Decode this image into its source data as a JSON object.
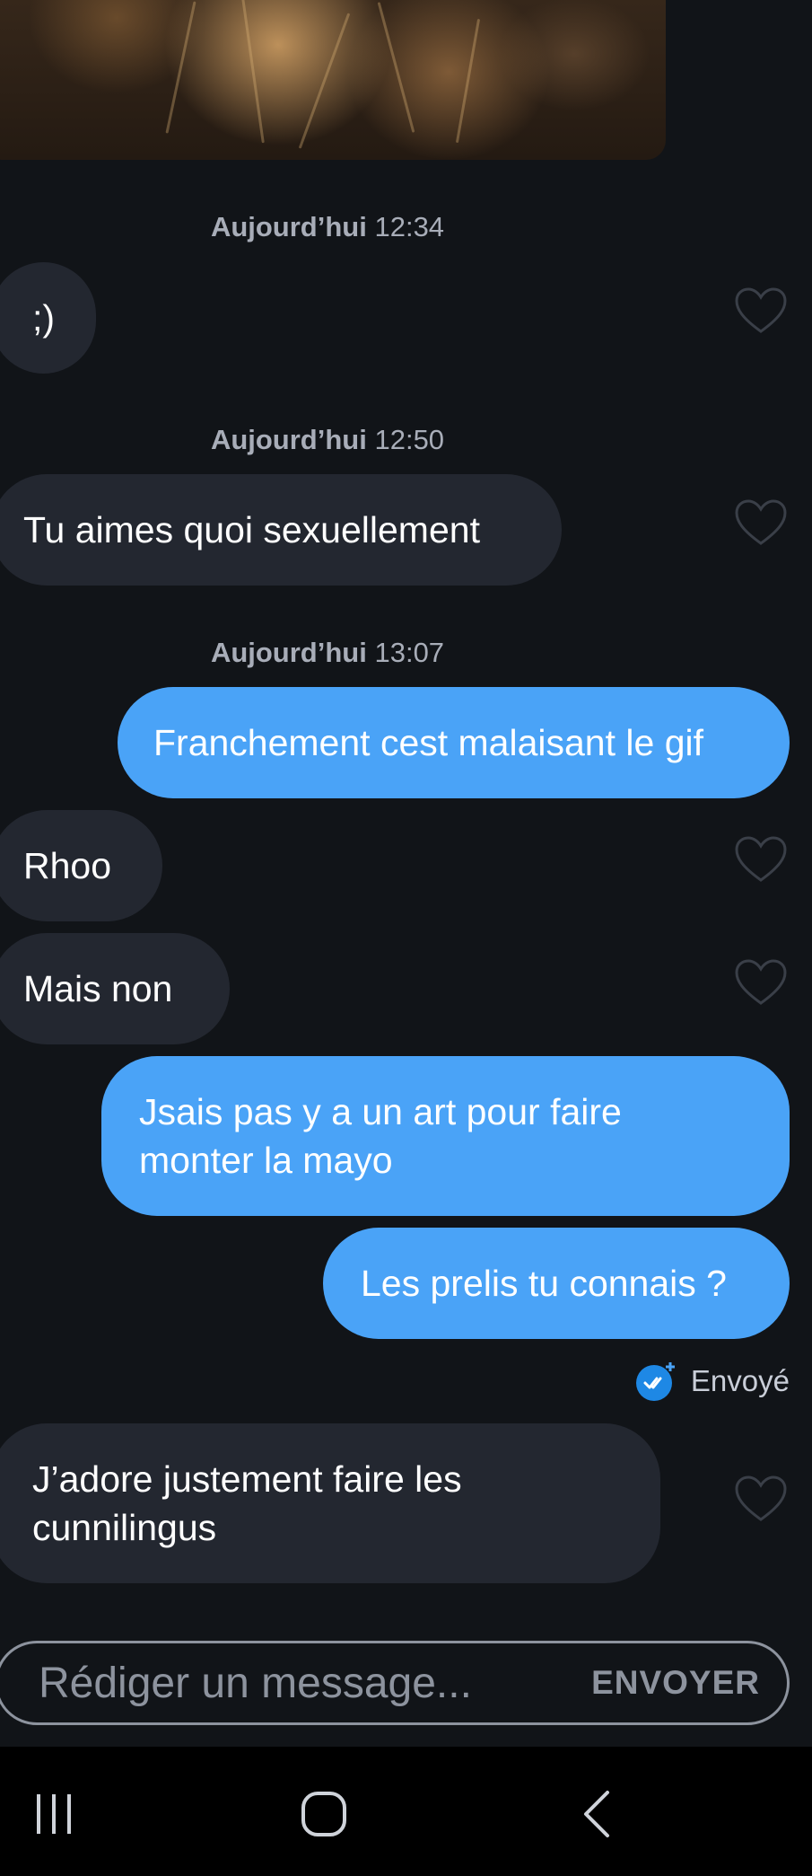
{
  "messages": [
    {
      "timestamp": {
        "day": "Aujourd’hui",
        "time": "12:34"
      }
    },
    {
      "text": ";)"
    },
    {
      "timestamp": {
        "day": "Aujourd’hui",
        "time": "12:50"
      }
    },
    {
      "text": "Tu aimes quoi sexuellement"
    },
    {
      "timestamp": {
        "day": "Aujourd’hui",
        "time": "13:07"
      }
    },
    {
      "text": "Franchement cest malaisant le gif"
    },
    {
      "text": "Rhoo"
    },
    {
      "text": "Mais non"
    },
    {
      "text_line1": "Jsais pas y a un art pour faire",
      "text_line2": "monter la mayo"
    },
    {
      "text": "Les prelis tu connais ?"
    },
    {
      "status": "Envoyé"
    },
    {
      "text_line1": "J’adore justement faire les",
      "text_line2": "cunnilingus"
    }
  ],
  "composer": {
    "placeholder": "Rédiger un message...",
    "send_label": "ENVOYER"
  },
  "colors": {
    "background": "#111418",
    "incoming_bubble": "#232730",
    "outgoing_bubble": "#4aa3f7",
    "timestamp": "#a8adb8"
  }
}
